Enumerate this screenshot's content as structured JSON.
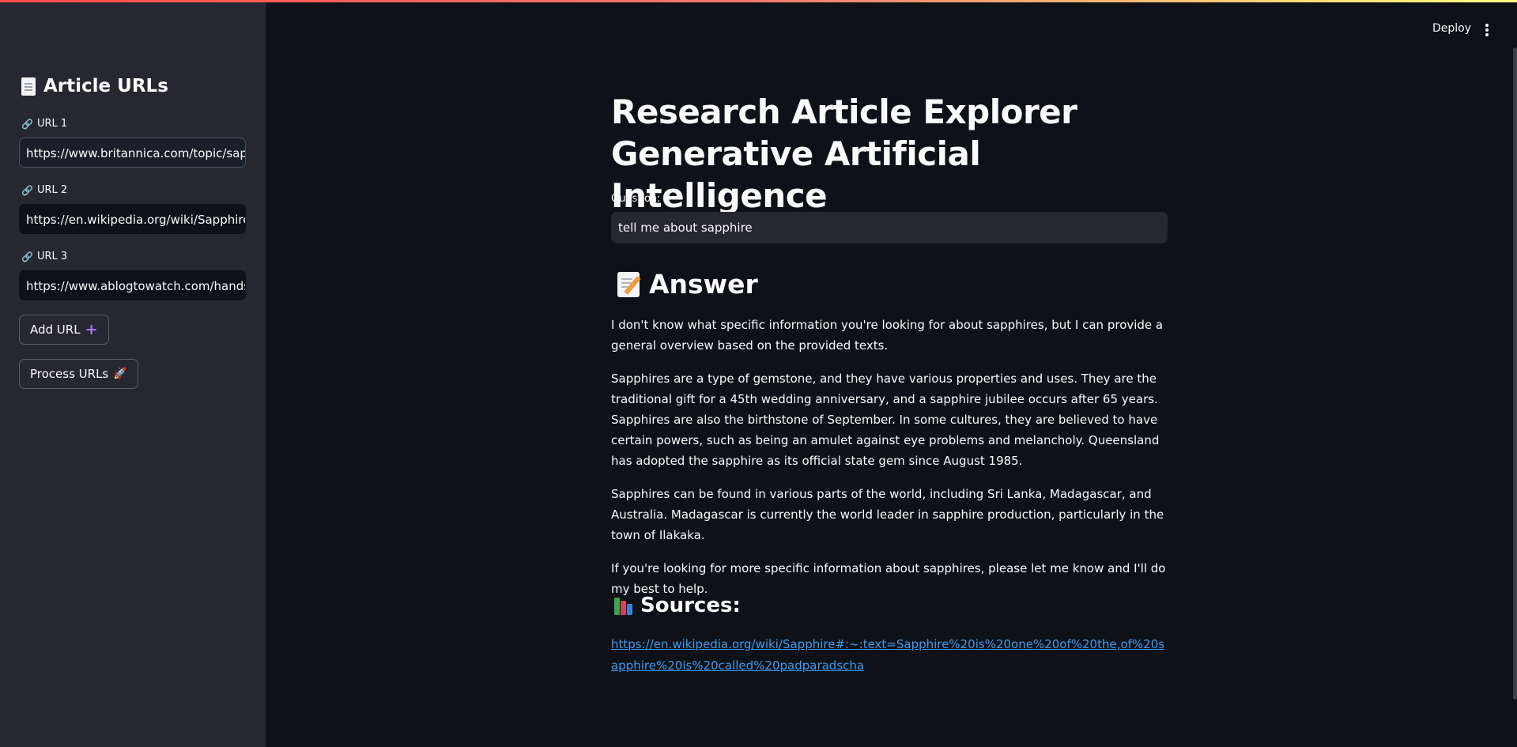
{
  "header": {
    "deploy_label": "Deploy"
  },
  "sidebar": {
    "title": "Article URLs",
    "urls": [
      {
        "label": "URL 1",
        "value": "https://www.britannica.com/topic/sappl"
      },
      {
        "label": "URL 2",
        "value": "https://en.wikipedia.org/wiki/Sapphire#:"
      },
      {
        "label": "URL 3",
        "value": "https://www.ablogtowatch.com/hands-c"
      }
    ],
    "add_url_label": "Add URL",
    "process_urls_label": "Process URLs"
  },
  "main": {
    "title_line1": "Research Article Explorer",
    "title_line2": "Generative Artificial Intelligence",
    "question_label": "Question:",
    "question_value": "tell me about sapphire",
    "answer_heading": "Answer",
    "answer_paragraphs": [
      "I don't know what specific information you're looking for about sapphires, but I can provide a general overview based on the provided texts.",
      "Sapphires are a type of gemstone, and they have various properties and uses. They are the traditional gift for a 45th wedding anniversary, and a sapphire jubilee occurs after 65 years. Sapphires are also the birthstone of September. In some cultures, they are believed to have certain powers, such as being an amulet against eye problems and melancholy. Queensland has adopted the sapphire as its official state gem since August 1985.",
      "Sapphires can be found in various parts of the world, including Sri Lanka, Madagascar, and Australia. Madagascar is currently the world leader in sapphire production, particularly in the town of Ilakaka.",
      "If you're looking for more specific information about sapphires, please let me know and I'll do my best to help."
    ],
    "sources_heading": "Sources:",
    "source_link": "https://en.wikipedia.org/wiki/Sapphire#:~:text=Sapphire%20is%20one%20of%20the,of%20sapphire%20is%20called%20padparadscha"
  },
  "colors": {
    "background": "#0e1117",
    "sidebar": "#262730",
    "link": "#3d9df3",
    "accent_plus": "#a274ff"
  }
}
